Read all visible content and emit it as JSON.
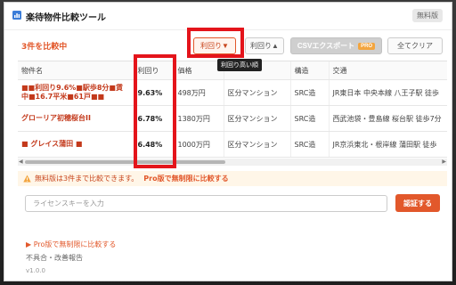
{
  "app": {
    "title": "楽待物件比較ツール",
    "plan_badge": "無料版"
  },
  "toolbar": {
    "count_text": "3件を比較中",
    "sort_yield_desc_label": "利回り▼",
    "sort_yield_asc_label": "利回り▲",
    "csv_export_label": "CSVエクスポート",
    "csv_pro_tag": "PRO",
    "clear_all_label": "全てクリア",
    "tooltip": "利回り高い順"
  },
  "table": {
    "columns": [
      "物件名",
      "利回り",
      "価格",
      "",
      "構造",
      "交通"
    ],
    "rows": [
      {
        "name": "■■利回り9.6%■駅歩8分■賃中■16.7平米■61戸■■",
        "yield": "9.63%",
        "price": "498万円",
        "type": "区分マンション",
        "structure": "SRC造",
        "access": "JR東日本 中央本線 八王子駅 徒歩"
      },
      {
        "name": "グローリア初穂桜台II",
        "yield": "6.78%",
        "price": "1380万円",
        "type": "区分マンション",
        "structure": "SRC造",
        "access": "西武池袋・豊島線 桜台駅 徒歩7分"
      },
      {
        "name": "■ グレイス蒲田 ■",
        "yield": "6.48%",
        "price": "1000万円",
        "type": "区分マンション",
        "structure": "SRC造",
        "access": "JR京浜東北・根岸線 蒲田駅 徒歩"
      }
    ]
  },
  "scroll": {
    "left_arrow": "◀",
    "right_arrow": "▶"
  },
  "notice": {
    "text": "無料版は3件まで比較できます。",
    "link": "Pro版で無制限に比較する"
  },
  "license": {
    "placeholder": "ライセンスキーを入力",
    "value": "",
    "submit_label": "認証する"
  },
  "footer": {
    "upgrade_link": "▶ Pro版で無制限に比較する",
    "report_link": "不具合・改善報告",
    "version": "v1.0.0"
  },
  "colors": {
    "accent": "#e2582b",
    "highlight_box": "#e4141b",
    "notice_bg": "#fff6e8"
  }
}
